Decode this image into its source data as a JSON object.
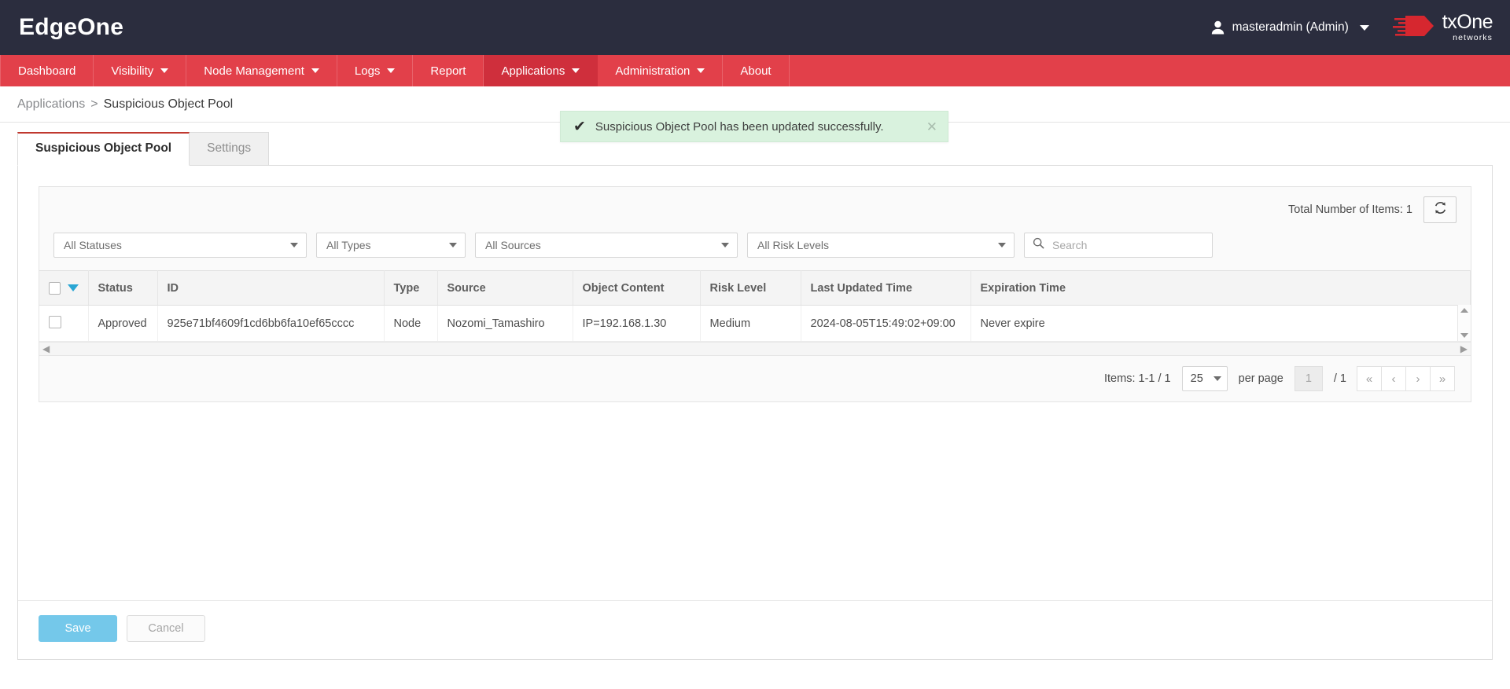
{
  "header": {
    "brand": "EdgeOne",
    "account_label": "masteradmin (Admin)",
    "account_icon": "person-icon",
    "account_caret_icon": "chevron-down-icon",
    "vendor_main": "txOne",
    "vendor_sub": "networks"
  },
  "nav": {
    "items": [
      {
        "label": "Dashboard",
        "has_caret": false,
        "active": false
      },
      {
        "label": "Visibility",
        "has_caret": true,
        "active": false
      },
      {
        "label": "Node Management",
        "has_caret": true,
        "active": false
      },
      {
        "label": "Logs",
        "has_caret": true,
        "active": false
      },
      {
        "label": "Report",
        "has_caret": false,
        "active": false
      },
      {
        "label": "Applications",
        "has_caret": true,
        "active": true
      },
      {
        "label": "Administration",
        "has_caret": true,
        "active": false
      },
      {
        "label": "About",
        "has_caret": false,
        "active": false
      }
    ]
  },
  "breadcrumb": {
    "parent": "Applications",
    "separator": ">",
    "current": "Suspicious Object Pool"
  },
  "toast": {
    "icon": "check-icon",
    "message": "Suspicious Object Pool has been updated successfully.",
    "close_icon": "close-icon"
  },
  "tabs": [
    {
      "label": "Suspicious Object Pool",
      "active": true
    },
    {
      "label": "Settings",
      "active": false
    }
  ],
  "toolbar": {
    "total_items_label": "Total Number of Items: 1",
    "refresh_icon": "refresh-icon"
  },
  "filters": {
    "status": "All Statuses",
    "type": "All Types",
    "source": "All Sources",
    "risk": "All Risk Levels",
    "search_placeholder": "Search",
    "search_value": "",
    "search_icon": "search-icon"
  },
  "table": {
    "columns": [
      "Status",
      "ID",
      "Type",
      "Source",
      "Object Content",
      "Risk Level",
      "Last Updated Time",
      "Expiration Time"
    ],
    "rows": [
      {
        "status": "Approved",
        "id": "925e71bf4609f1cd6bb6fa10ef65cccc",
        "type": "Node",
        "source": "Nozomi_Tamashiro",
        "object_content": "IP=192.168.1.30",
        "risk_level": "Medium",
        "last_updated_time": "2024-08-05T15:49:02+09:00",
        "expiration_time": "Never expire"
      }
    ]
  },
  "pagination": {
    "items_label": "Items: 1-1 / 1",
    "per_page_value": "25",
    "per_page_label": "per page",
    "current_page": "1",
    "total_pages": "/ 1",
    "first_icon": "«",
    "prev_icon": "‹",
    "next_icon": "›",
    "last_icon": "»"
  },
  "footer": {
    "save_label": "Save",
    "cancel_label": "Cancel"
  },
  "colors": {
    "topbar": "#2b2d3e",
    "nav": "#e2404a",
    "nav_active": "#cf2f3c",
    "tab_accent": "#c0392f",
    "toast_bg": "#d9f2de",
    "save_btn": "#74c8ea",
    "sort_caret": "#29a6d4"
  }
}
